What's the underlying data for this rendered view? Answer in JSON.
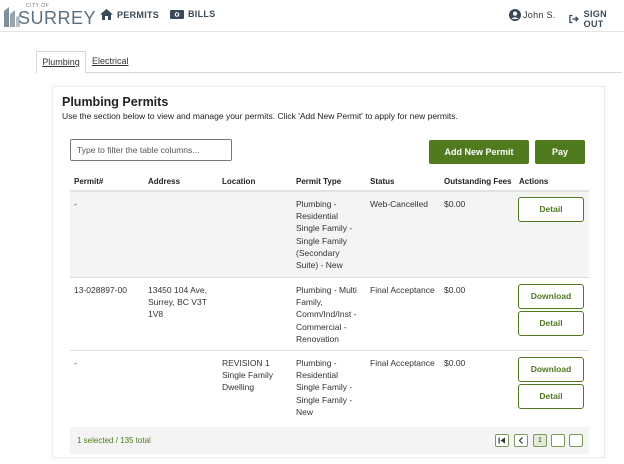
{
  "header": {
    "logo_small": "CITY OF",
    "logo_big": "SURREY",
    "nav_permits": "PERMITS",
    "nav_bills": "BILLS",
    "user_name": "John S.",
    "sign_out": "SIGN OUT"
  },
  "tabs": [
    {
      "label": "Plumbing",
      "active": true
    },
    {
      "label": "Electrical",
      "active": false
    }
  ],
  "main": {
    "title": "Plumbing Permits",
    "description": "Use the section below to view and manage your permits. Click 'Add New Permit' to apply for new permits.",
    "filter_placeholder": "Type to filter the table columns...",
    "add_button": "Add New Permit",
    "pay_button": "Pay"
  },
  "table": {
    "columns": [
      "Permit#",
      "Address",
      "Location",
      "Permit Type",
      "Status",
      "Outstanding Fees",
      "Actions"
    ],
    "rows": [
      {
        "permit": "-",
        "address": [
          "",
          "",
          ""
        ],
        "location": [
          "",
          "",
          ""
        ],
        "type": [
          "Plumbing -",
          "Residential",
          "Single Family -",
          "Single Family",
          "(Secondary",
          "Suite) - New"
        ],
        "status": "Web-Cancelled",
        "fees": "$0.00",
        "actions": [
          "Detail"
        ]
      },
      {
        "permit": "13-028897-00",
        "address": [
          "13450 104 Ave,",
          "Surrey, BC V3T",
          "1V8"
        ],
        "location": [
          "",
          "",
          ""
        ],
        "type": [
          "Plumbing - Multi",
          "Family,",
          "Comm/Ind/Inst -",
          "Commercial -",
          "Renovation",
          ""
        ],
        "status": "Final Acceptance",
        "fees": "$0.00",
        "actions": [
          "Download",
          "Detail"
        ]
      },
      {
        "permit": "-",
        "address": [
          "",
          "",
          ""
        ],
        "location": [
          "REVISION 1",
          "Single Family",
          "Dwelling"
        ],
        "type": [
          "Plumbing -",
          "Residential",
          "Single Family -",
          "Single Family -",
          "New",
          ""
        ],
        "status": "Final Acceptance",
        "fees": "$0.00",
        "actions": [
          "Download",
          "Detail"
        ]
      }
    ]
  },
  "footer": {
    "summary": "1 selected / 135 total",
    "pages": [
      "1"
    ]
  },
  "colors": {
    "accent": "#4f7a1e",
    "row_shade": "#f4f4f4",
    "nav_text": "#3a4a5a"
  }
}
